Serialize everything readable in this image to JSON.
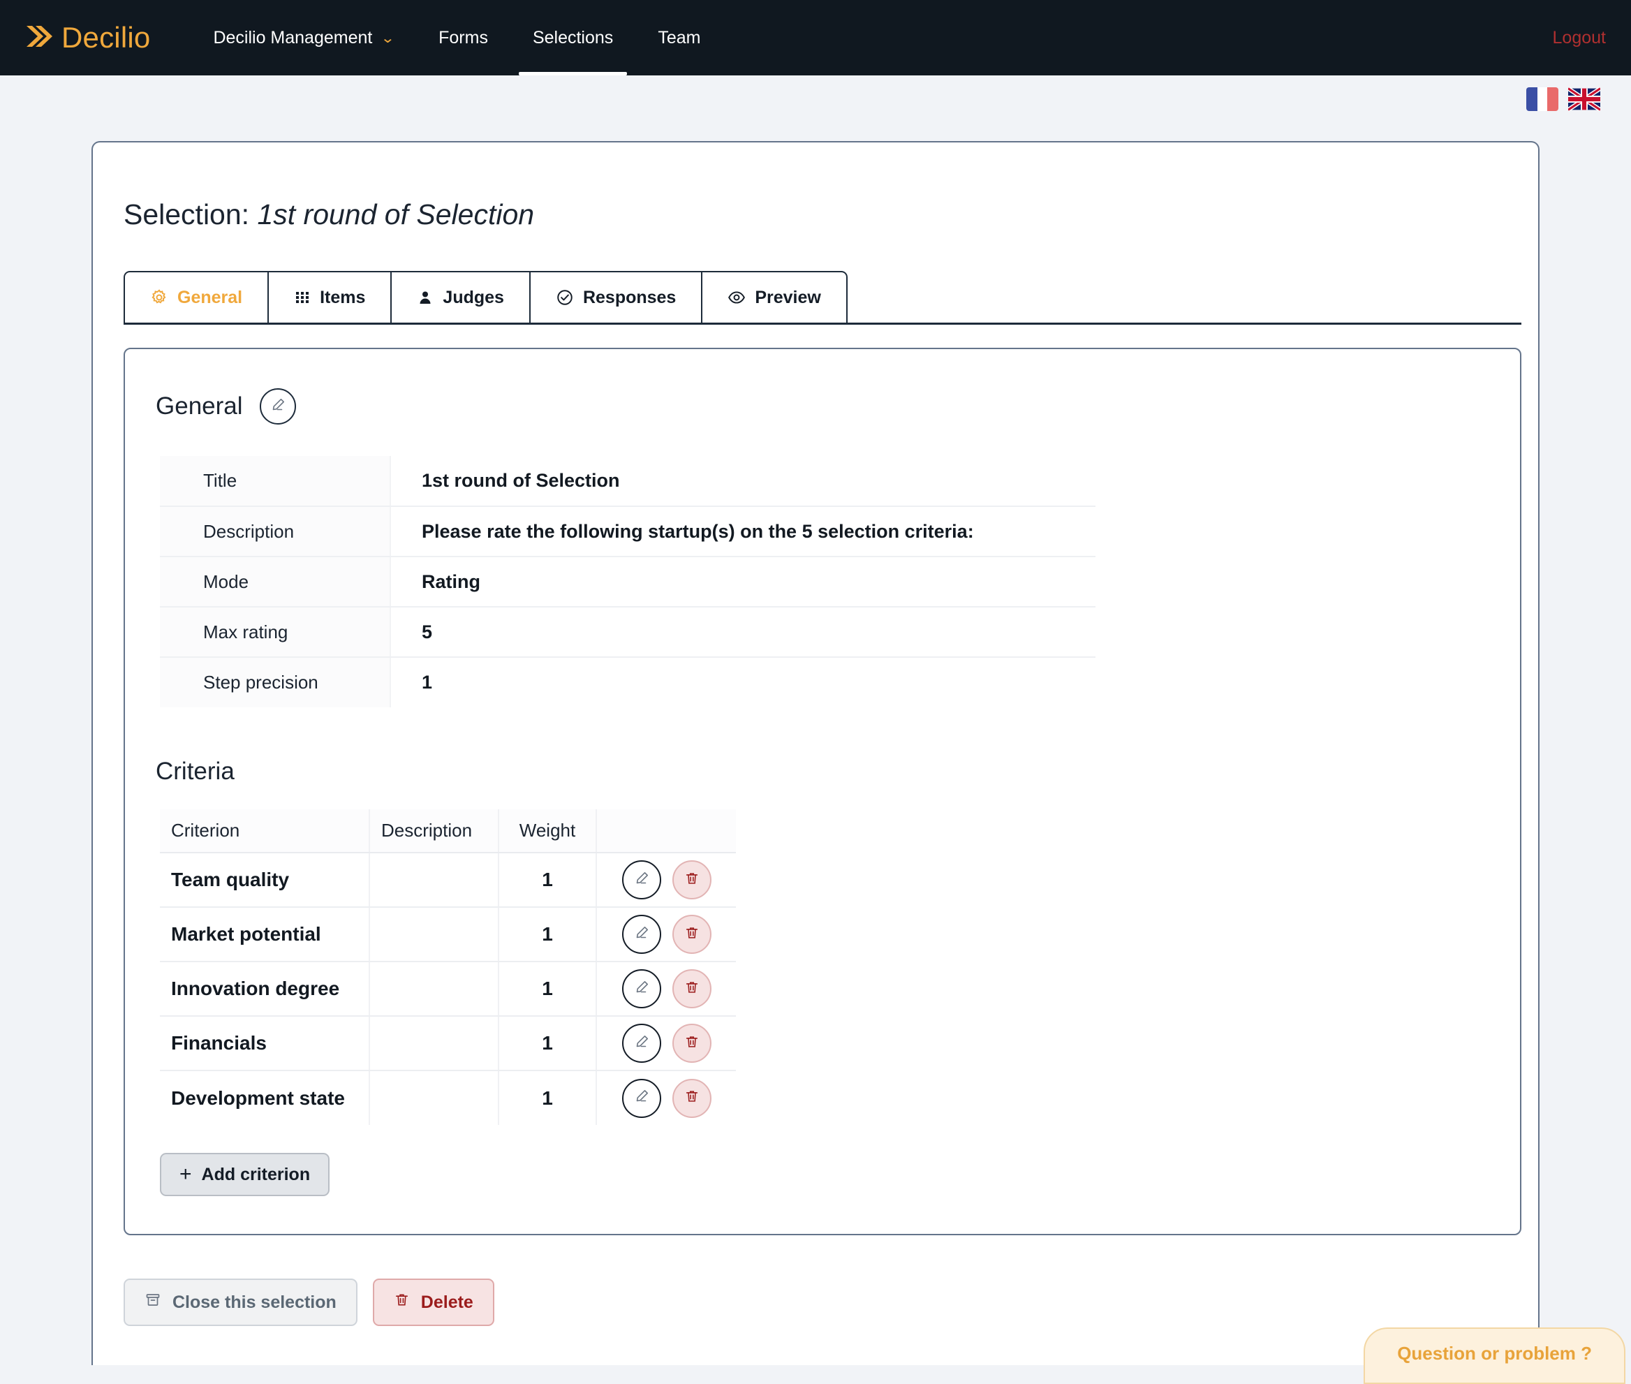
{
  "navbar": {
    "brand": "Decilio",
    "brand_icon": "double-chevron-right-icon",
    "brand_color": "#f0a83c",
    "items": [
      {
        "label": "Decilio Management",
        "has_caret": true,
        "active": false
      },
      {
        "label": "Forms",
        "has_caret": false,
        "active": false
      },
      {
        "label": "Selections",
        "has_caret": false,
        "active": true
      },
      {
        "label": "Team",
        "has_caret": false,
        "active": false
      }
    ],
    "logout_label": "Logout",
    "logout_color": "#b03030",
    "background": "#101820"
  },
  "language_bar": {
    "flags": [
      {
        "name": "french-flag-icon",
        "code": "fr"
      },
      {
        "name": "uk-flag-icon",
        "code": "en"
      }
    ]
  },
  "header": {
    "title_prefix": "Selection:",
    "title_value": "1st round of Selection"
  },
  "tabs": [
    {
      "label": "General",
      "icon": "gear-icon",
      "active": true
    },
    {
      "label": "Items",
      "icon": "grid-icon",
      "active": false
    },
    {
      "label": "Judges",
      "icon": "person-icon",
      "active": false
    },
    {
      "label": "Responses",
      "icon": "check-circle-icon",
      "active": false
    },
    {
      "label": "Preview",
      "icon": "eye-icon",
      "active": false
    }
  ],
  "general": {
    "section_title": "General",
    "edit_icon": "pencil-icon",
    "rows": [
      {
        "label": "Title",
        "value": "1st round of Selection"
      },
      {
        "label": "Description",
        "value": "Please rate the following startup(s) on the 5 selection criteria:"
      },
      {
        "label": "Mode",
        "value": "Rating"
      },
      {
        "label": "Max rating",
        "value": "5"
      },
      {
        "label": "Step precision",
        "value": "1"
      }
    ]
  },
  "criteria": {
    "section_title": "Criteria",
    "columns": [
      "Criterion",
      "Description",
      "Weight",
      ""
    ],
    "rows": [
      {
        "criterion": "Team quality",
        "description": "",
        "weight": "1"
      },
      {
        "criterion": "Market potential",
        "description": "",
        "weight": "1"
      },
      {
        "criterion": "Innovation degree",
        "description": "",
        "weight": "1"
      },
      {
        "criterion": "Financials",
        "description": "",
        "weight": "1"
      },
      {
        "criterion": "Development state",
        "description": "",
        "weight": "1"
      }
    ],
    "row_edit_icon": "pencil-icon",
    "row_delete_icon": "trash-icon",
    "add_button": {
      "label": "Add criterion",
      "icon": "plus-icon"
    }
  },
  "footer": {
    "close_button": {
      "label": "Close this selection",
      "icon": "archive-icon"
    },
    "delete_button": {
      "label": "Delete",
      "icon": "trash-icon",
      "color": "#9b1c1c"
    }
  },
  "help_widget": {
    "label": "Question or problem ?",
    "color": "#e8a33a"
  }
}
